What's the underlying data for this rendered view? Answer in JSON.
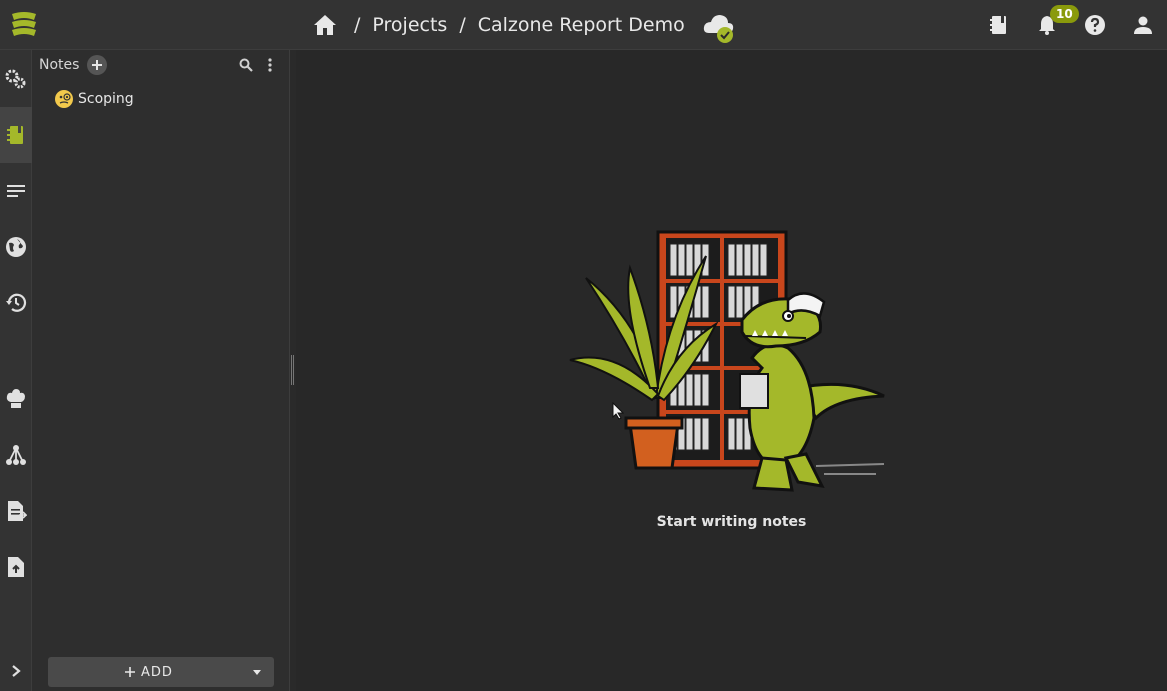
{
  "header": {
    "breadcrumb": [
      "Projects",
      "Calzone Report Demo"
    ],
    "separator": "/",
    "notification_count": "10",
    "icons": [
      "home-icon",
      "cloud-sync-icon",
      "notes-book-icon",
      "bell-icon",
      "help-icon",
      "account-icon"
    ]
  },
  "rail": {
    "icons": [
      "settings-icon",
      "notes-icon",
      "list-icon",
      "globe-icon",
      "history-icon",
      "chef-hat-icon",
      "tree-icon",
      "report-icon",
      "upload-file-icon",
      "expand-icon"
    ],
    "active": "notes-icon"
  },
  "sidebar": {
    "title": "Notes",
    "items": [
      {
        "label": "Scoping",
        "icon": "monocle-face-icon"
      }
    ],
    "add_button_label": "ADD"
  },
  "main": {
    "empty_message": "Start writing notes"
  },
  "colors": {
    "accent": "#a4b82a",
    "background": "#282828",
    "panel": "#2e2e2e"
  }
}
